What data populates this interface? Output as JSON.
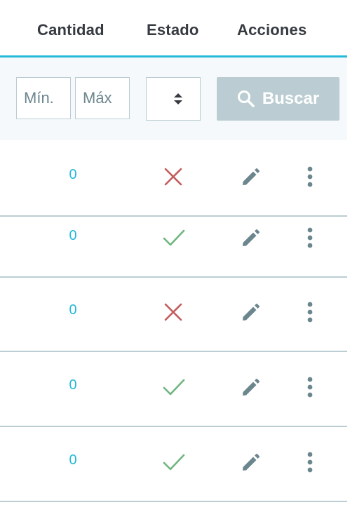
{
  "header": {
    "quantity_label": "Cantidad",
    "status_label": "Estado",
    "actions_label": "Acciones"
  },
  "filters": {
    "min_placeholder": "Mín.",
    "max_placeholder": "Máx",
    "min_value": "",
    "max_value": "",
    "status_select_value": "",
    "search_label": "Buscar",
    "search_icon": "search-icon",
    "select_icon": "sort-caret-icon"
  },
  "rows": [
    {
      "quantity": "0",
      "status": "inactive",
      "status_icon": "cross-icon"
    },
    {
      "quantity": "0",
      "status": "active",
      "status_icon": "check-icon"
    },
    {
      "quantity": "0",
      "status": "inactive",
      "status_icon": "cross-icon"
    },
    {
      "quantity": "0",
      "status": "active",
      "status_icon": "check-icon"
    },
    {
      "quantity": "0",
      "status": "active",
      "status_icon": "check-icon"
    }
  ],
  "row_actions": {
    "edit_icon": "pencil-icon",
    "more_icon": "vertical-dots-icon"
  },
  "colors": {
    "accent": "#25b9d7",
    "active": "#70b580",
    "inactive": "#c45c5c",
    "icon_gray": "#6c868e",
    "border": "#bbcdd2",
    "filter_bg": "#f6f9fb",
    "heading": "#363a41"
  }
}
